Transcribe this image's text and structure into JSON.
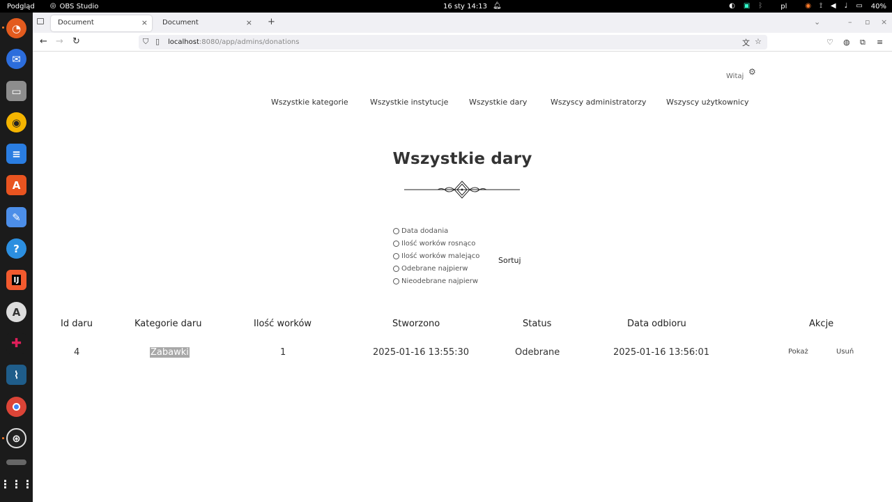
{
  "topbar": {
    "activities": "Podgląd",
    "app_name": "OBS Studio",
    "datetime": "16 sty 14:13",
    "language": "pl",
    "battery": "40%"
  },
  "dock": {
    "apps": [
      "firefox-icon",
      "thunderbird-icon",
      "files-icon",
      "rhythmbox-icon",
      "writer-icon",
      "app-center-icon",
      "text-editor-icon",
      "help-icon",
      "intellij-icon",
      "software-updater-icon",
      "slack-icon",
      "mysql-workbench-icon",
      "chrome-icon",
      "obs-icon",
      "trash-icon",
      "show-apps-icon"
    ]
  },
  "browser": {
    "tabs": [
      {
        "label": "Document",
        "active": true
      },
      {
        "label": "Document",
        "active": false
      }
    ],
    "url_host": "localhost",
    "url_path": ":8080/app/admins/donations"
  },
  "page": {
    "greeting": "Witaj",
    "menu": [
      "Wszystkie kategorie",
      "Wszystkie instytucje",
      "Wszystkie dary",
      "Wszyscy administratorzy",
      "Wszyscy użytkownicy"
    ],
    "title": "Wszystkie dary",
    "sort_options": [
      "Data dodania",
      "Ilość worków rosnąco",
      "Ilość worków malejąco",
      "Odebrane najpierw",
      "Nieodebrane najpierw"
    ],
    "sort_button": "Sortuj",
    "table": {
      "headers": [
        "Id daru",
        "Kategorie daru",
        "Ilość worków",
        "Stworzono",
        "Status",
        "Data odbioru",
        "Akcje"
      ],
      "rows": [
        {
          "id": "4",
          "category": "Zabawki",
          "bags": "1",
          "created": "2025-01-16 13:55:30",
          "status": "Odebrane",
          "pickup": "2025-01-16 13:56:01",
          "action_show": "Pokaż",
          "action_delete": "Usuń"
        }
      ]
    }
  }
}
